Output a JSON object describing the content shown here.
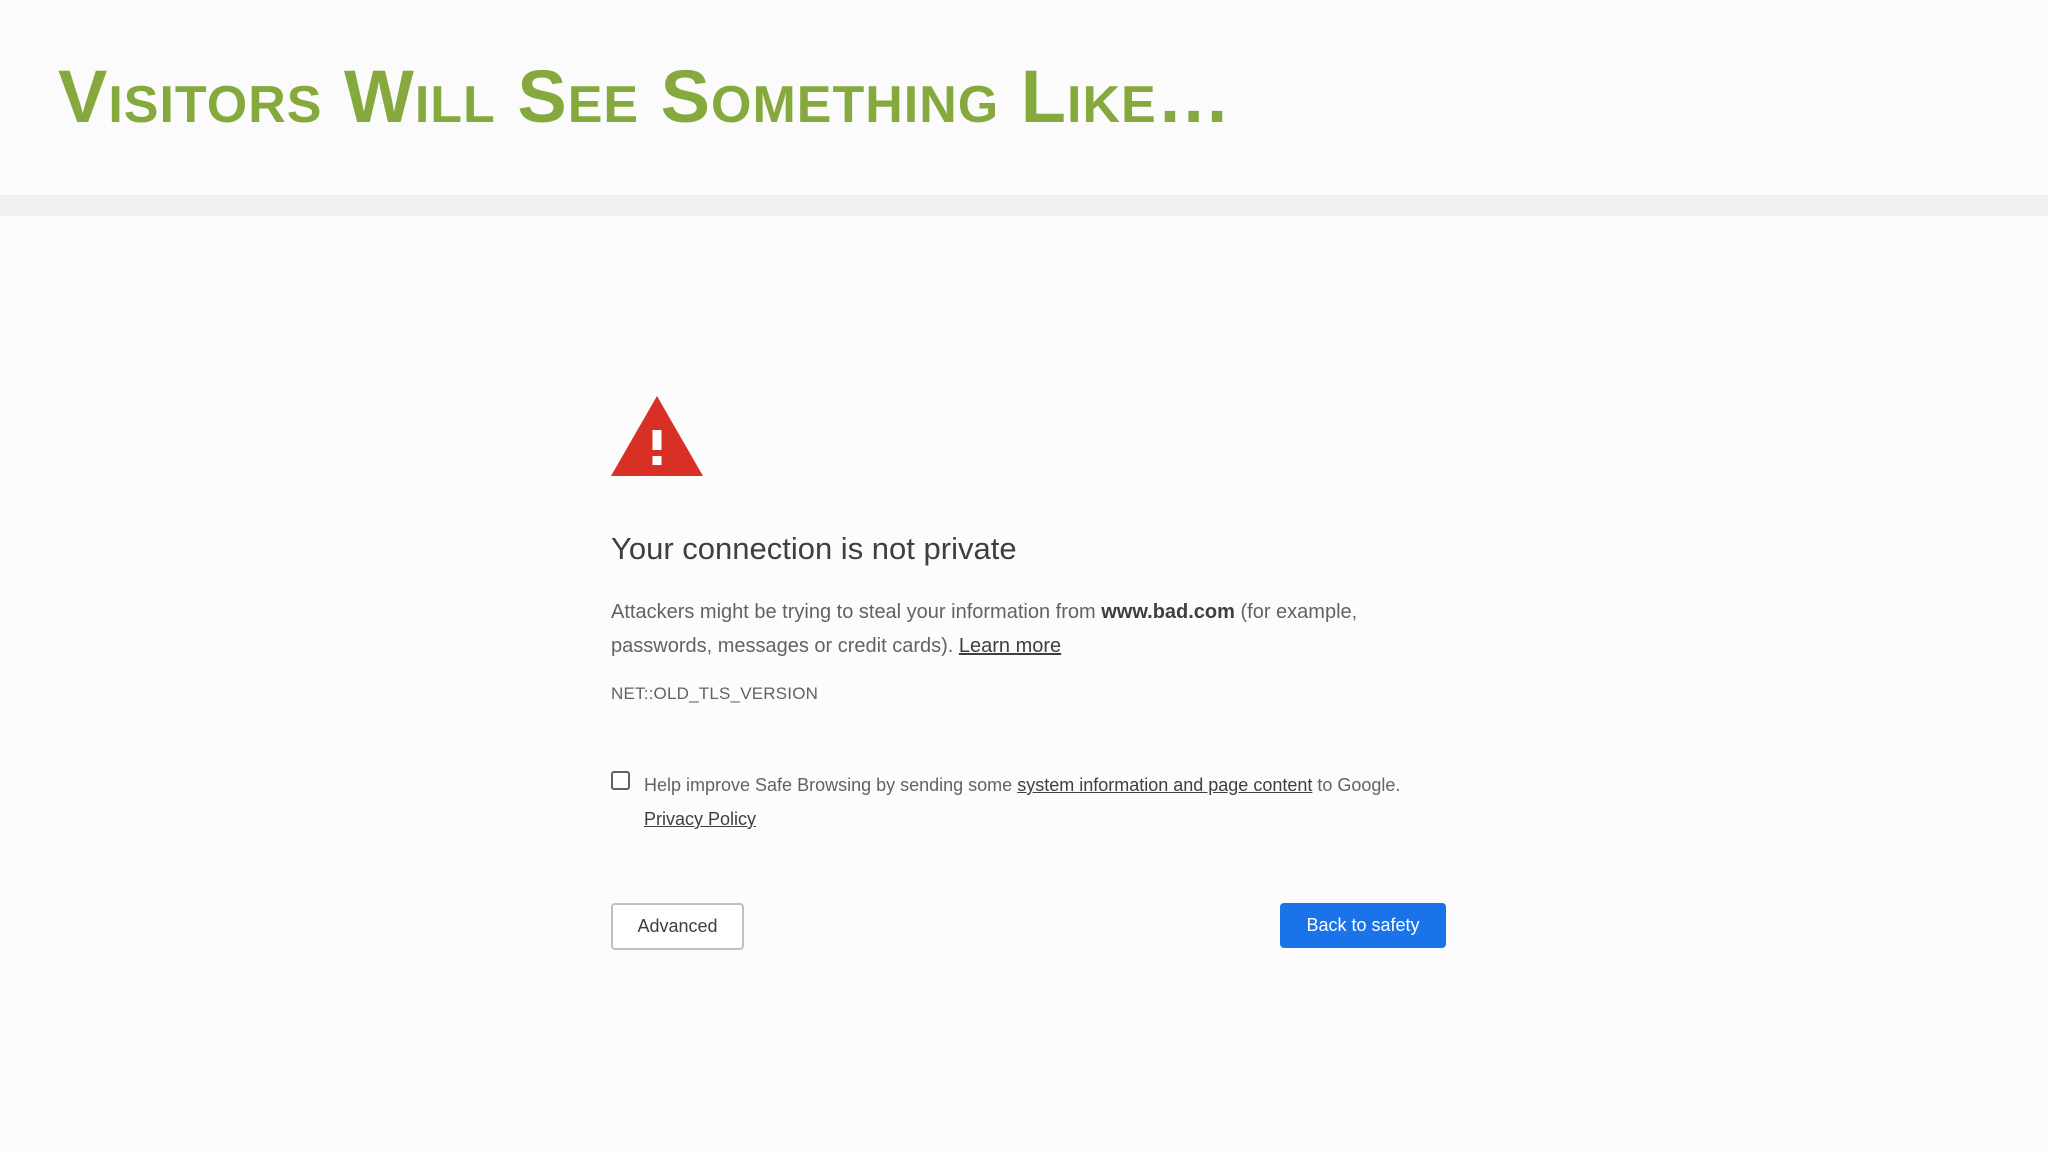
{
  "slide": {
    "title": "Visitors Will See Something Like…"
  },
  "interstitial": {
    "icon": "warning-triangle-icon",
    "heading": "Your connection is not private",
    "body": {
      "part1": "Attackers might be trying to steal your information from ",
      "domain": "www.bad.com",
      "part2": " (for example, passwords, messages or credit cards). ",
      "learn_more": "Learn more"
    },
    "error_code": "NET::OLD_TLS_VERSION",
    "safe_browsing": {
      "checked": false,
      "part1": "Help improve Safe Browsing by sending some ",
      "link": "system information and page content",
      "part2": " to Google. ",
      "privacy_policy": "Privacy Policy"
    },
    "buttons": {
      "advanced": "Advanced",
      "back_to_safety": "Back to safety"
    }
  },
  "colors": {
    "title_green": "#86a93e",
    "warning_red": "#d93025",
    "primary_blue": "#1a73e8"
  }
}
